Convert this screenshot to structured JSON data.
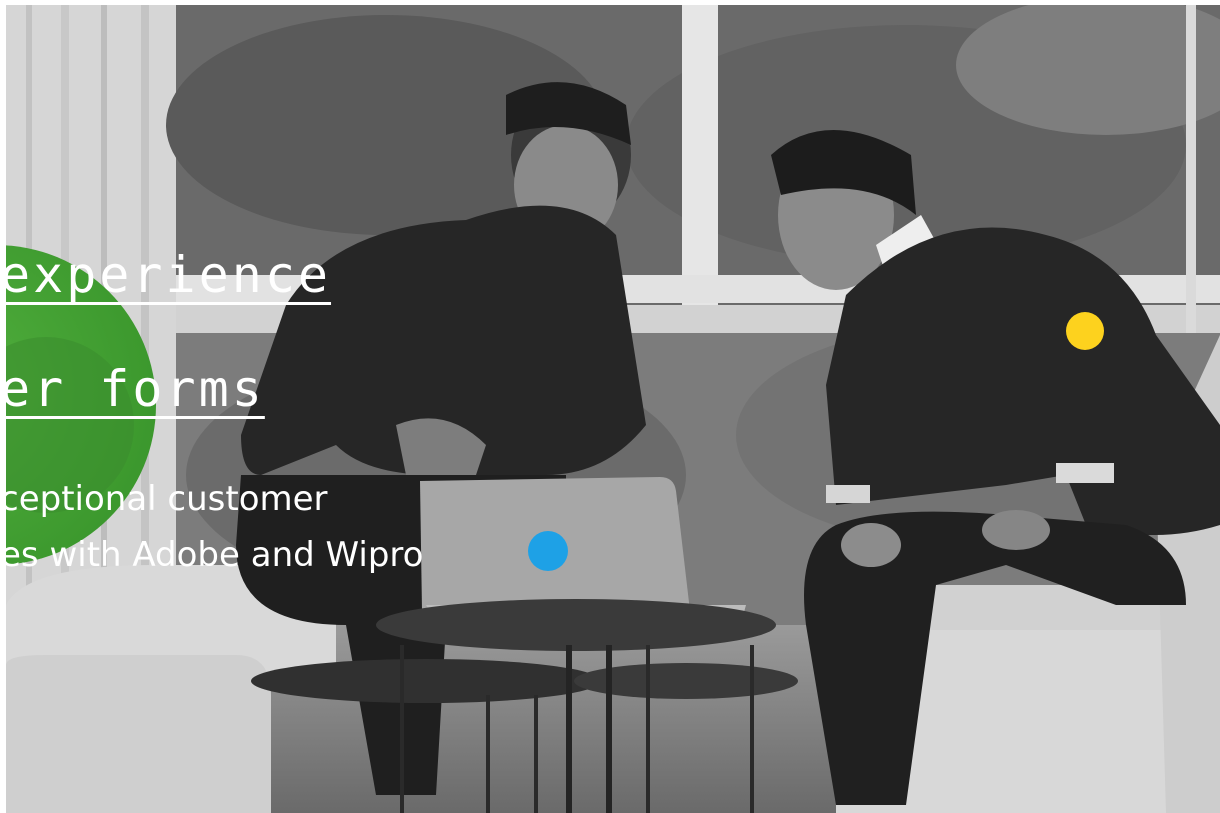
{
  "hero": {
    "headline_line1": "experience",
    "headline_line2": "er forms",
    "subtitle_line1": "ceptional customer",
    "subtitle_line2": "es with Adobe and Wipro"
  },
  "colors": {
    "green_circle": "#47a434",
    "green_circle_inner": "#3a8f2b",
    "dot_yellow": "#fdd21e",
    "dot_blue": "#1ea1e6",
    "text": "#ffffff",
    "frame": "#ffffff"
  },
  "icons": {
    "accent_dot_1": "yellow-dot-icon",
    "accent_dot_2": "blue-dot-icon"
  }
}
